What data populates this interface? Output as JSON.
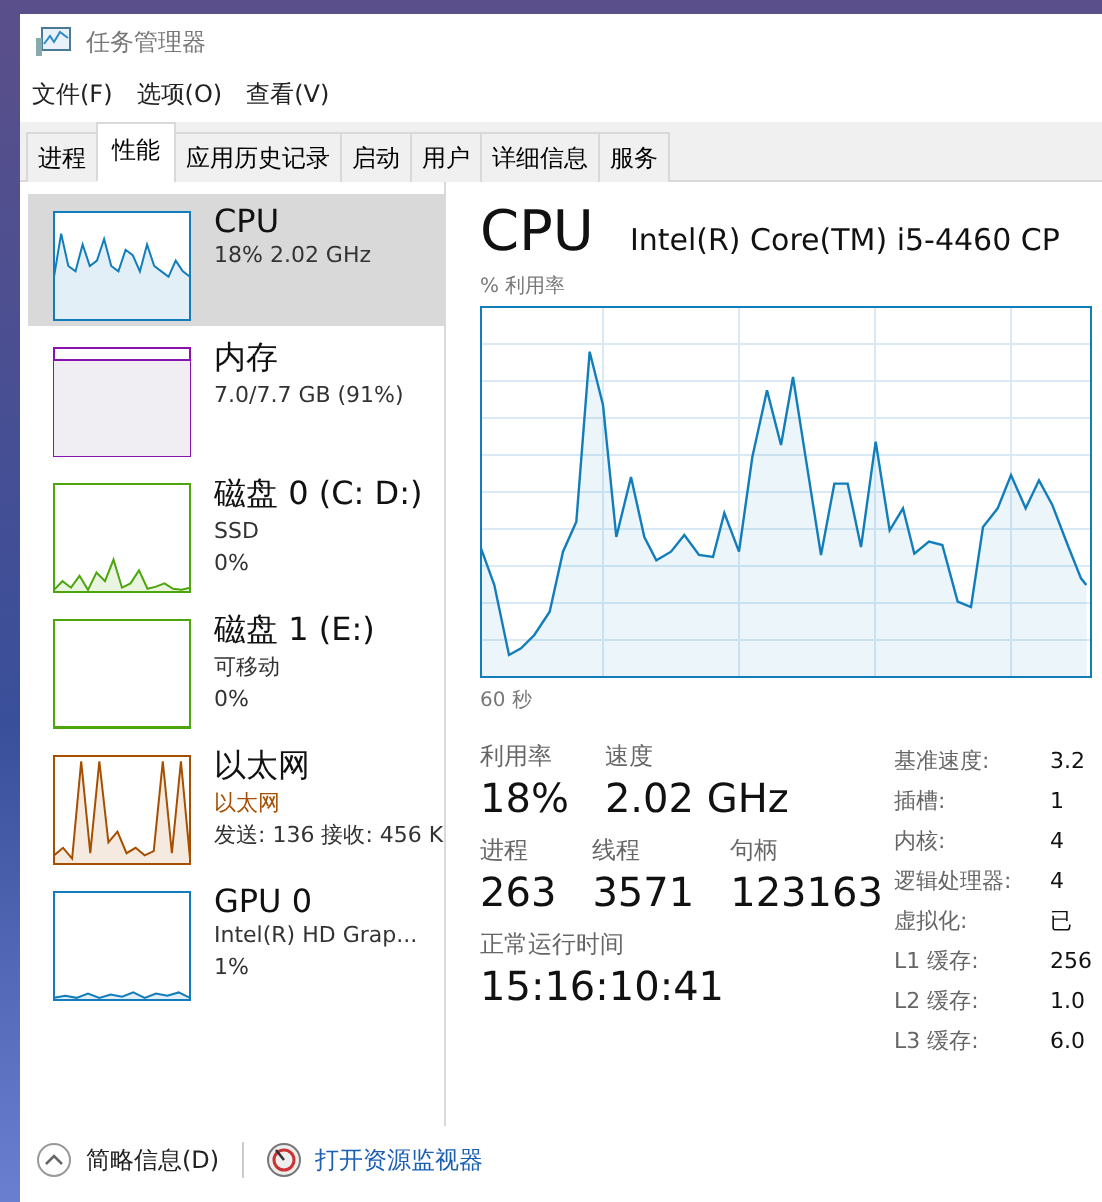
{
  "window": {
    "title": "任务管理器"
  },
  "menu": [
    "文件(F)",
    "选项(O)",
    "查看(V)"
  ],
  "tabs": [
    {
      "label": "进程",
      "selected": false
    },
    {
      "label": "性能",
      "selected": true
    },
    {
      "label": "应用历史记录",
      "selected": false
    },
    {
      "label": "启动",
      "selected": false
    },
    {
      "label": "用户",
      "selected": false
    },
    {
      "label": "详细信息",
      "selected": false
    },
    {
      "label": "服务",
      "selected": false
    }
  ],
  "sidebar": {
    "items": [
      {
        "kind": "cpu",
        "title": "CPU",
        "lines": [
          "18% 2.02 GHz"
        ],
        "color": "#117dbb",
        "selected": true
      },
      {
        "kind": "memory",
        "title": "内存",
        "lines": [
          "7.0/7.7 GB (91%)"
        ],
        "color": "#8b12ae",
        "selected": false
      },
      {
        "kind": "disk",
        "title": "磁盘 0 (C: D:)",
        "lines": [
          "SSD",
          "0%"
        ],
        "color": "#4da60c",
        "selected": false
      },
      {
        "kind": "disk_idle",
        "title": "磁盘 1 (E:)",
        "lines": [
          "可移动",
          "0%"
        ],
        "color": "#4da60c",
        "selected": false
      },
      {
        "kind": "network",
        "title": "以太网",
        "lines": [
          "以太网",
          "发送: 136 接收: 456 K"
        ],
        "color": "#a74f01",
        "selected": false
      },
      {
        "kind": "gpu",
        "title": "GPU 0",
        "lines": [
          "Intel(R) HD Grap...",
          "1%"
        ],
        "color": "#117dbb",
        "selected": false
      }
    ]
  },
  "main": {
    "title": "CPU",
    "processor": "Intel(R) Core(TM) i5-4460 CP",
    "chart_label": "% 利用率",
    "time_label": "60 秒",
    "stats": [
      [
        {
          "label": "利用率",
          "value": "18%"
        },
        {
          "label": "速度",
          "value": "2.02 GHz"
        }
      ],
      [
        {
          "label": "进程",
          "value": "263"
        },
        {
          "label": "线程",
          "value": "3571"
        },
        {
          "label": "句柄",
          "value": "123163"
        }
      ],
      [
        {
          "label": "正常运行时间",
          "value": "15:16:10:41"
        }
      ]
    ],
    "details": [
      {
        "label": "基准速度:",
        "value": "3.2"
      },
      {
        "label": "插槽:",
        "value": "1"
      },
      {
        "label": "内核:",
        "value": "4"
      },
      {
        "label": "逻辑处理器:",
        "value": "4"
      },
      {
        "label": "虚拟化:",
        "value": "已"
      },
      {
        "label": "L1 缓存:",
        "value": "256"
      },
      {
        "label": "L2 缓存:",
        "value": "1.0"
      },
      {
        "label": "L3 缓存:",
        "value": "6.0"
      }
    ]
  },
  "footer": {
    "summary": "简略信息(D)",
    "link": "打开资源监视器"
  }
}
